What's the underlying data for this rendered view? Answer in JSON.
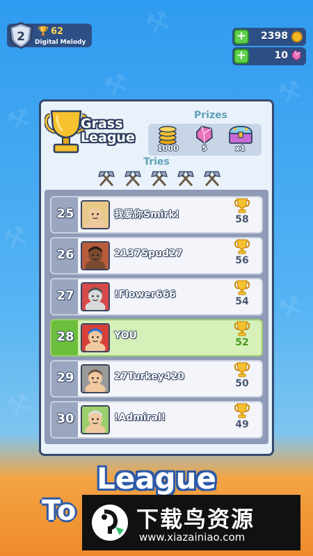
{
  "player": {
    "level": "2",
    "trophies": "62",
    "name": "Digital Melody"
  },
  "currency": {
    "coins": "2398",
    "gems": "10"
  },
  "league": {
    "title_line1": "Grass",
    "title_line2": "League",
    "prizes_label": "Prizes",
    "prizes": [
      {
        "icon": "gold-coins-icon",
        "value": "1000"
      },
      {
        "icon": "pink-gem-icon",
        "value": "5"
      },
      {
        "icon": "treasure-chest-icon",
        "value": "x1"
      }
    ],
    "tries_label": "Tries",
    "tries_count": 5
  },
  "leaderboard": [
    {
      "rank": "25",
      "name": "我爱你Smirk!",
      "score": "58",
      "you": false,
      "avatar_color": "#e9c98a",
      "skin": "#f1c9a0",
      "hair": "#e8d080"
    },
    {
      "rank": "26",
      "name": "2137Spud27",
      "score": "56",
      "you": false,
      "avatar_color": "#b85c3c",
      "skin": "#7a4a30",
      "hair": "#2a1d14"
    },
    {
      "rank": "27",
      "name": "!Flower666",
      "score": "54",
      "you": false,
      "avatar_color": "#d64a4a",
      "skin": "#d9d9d9",
      "hair": "#555555"
    },
    {
      "rank": "28",
      "name": "YOU",
      "score": "52",
      "you": true,
      "avatar_color": "#d6423a",
      "skin": "#f1c9a0",
      "hair": "#2a6fd6"
    },
    {
      "rank": "29",
      "name": "27Turkey420",
      "score": "50",
      "you": false,
      "avatar_color": "#9a9a9a",
      "skin": "#f1c9a0",
      "hair": "#6b5a48"
    },
    {
      "rank": "30",
      "name": "!Admiral!",
      "score": "49",
      "you": false,
      "avatar_color": "#9ccf6c",
      "skin": "#f1c9a0",
      "hair": "#dddddd"
    }
  ],
  "bottom": {
    "title": "League",
    "subtitle": "To"
  },
  "watermark": {
    "text": "下载鸟资源",
    "url": "www.xiazainiao.com"
  },
  "colors": {
    "accent": "#2d4f86",
    "you_row": "#d5f0b8",
    "gold": "#f2b824"
  }
}
